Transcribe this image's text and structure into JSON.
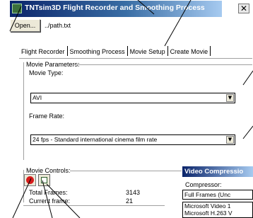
{
  "window": {
    "title": "TNTsim3D Flight Recorder and Smoothing Process",
    "close_glyph": "✕"
  },
  "toolbar": {
    "open_label": "Open...",
    "path": "../path.txt"
  },
  "tabs": [
    {
      "label": "Flight Recorder",
      "active": false
    },
    {
      "label": "Smoothing Process",
      "active": false
    },
    {
      "label": "Movie Setup",
      "active": false
    },
    {
      "label": "Create Movie",
      "active": true
    }
  ],
  "movie_parameters": {
    "group_label": "Movie Parameters:",
    "type_label": "Movie Type:",
    "type_value": "AVI",
    "rate_label": "Frame Rate:",
    "rate_value": "24 fps - Standard international cinema film rate"
  },
  "movie_controls": {
    "group_label": "Movie Controls:",
    "total_frames_label": "Total Frames:",
    "total_frames_value": "3143",
    "current_frame_label": "Current frame:",
    "current_frame_value": "21"
  },
  "video_compression": {
    "title": "Video Compressio",
    "compressor_label": "Compressor:",
    "compressor_value": "Full Frames (Unc",
    "options": [
      "Microsoft Video 1",
      "Microsoft H.263 V"
    ]
  },
  "icons": {
    "record": "red-dot",
    "film": "film-frame"
  },
  "colors": {
    "titlebar_start": "#0a246a",
    "titlebar_end": "#a6caf0",
    "record_red": "#d61b1b"
  }
}
